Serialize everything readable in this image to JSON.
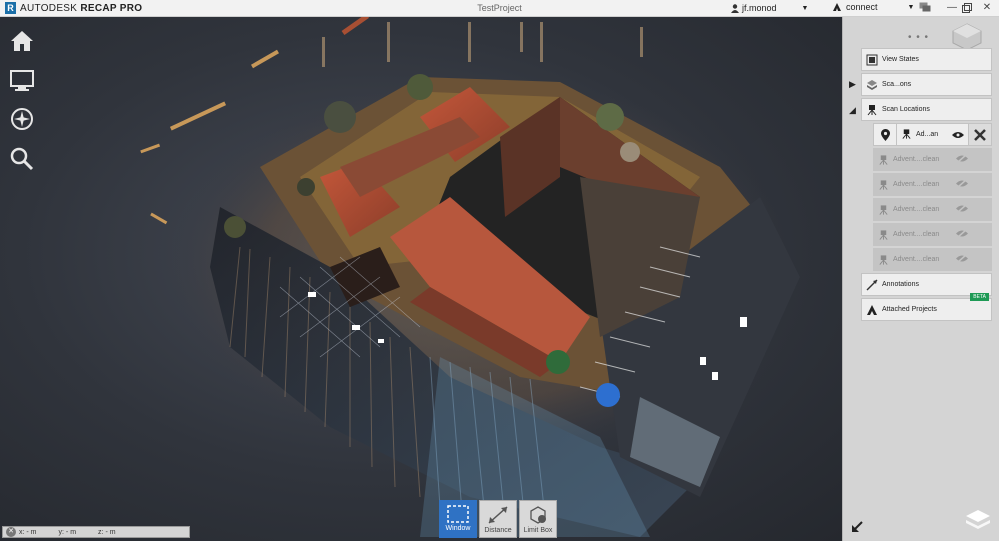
{
  "app": {
    "brand_prefix": "AUTODESK",
    "brand_product": "RECAP PRO",
    "project_title": "TestProject",
    "user": "jf.monod",
    "connect_label": "connect",
    "icons": [
      "recap-logo-icon",
      "user-icon",
      "connect-icon",
      "chat-icon",
      "minimize-icon",
      "restore-icon",
      "close-icon"
    ]
  },
  "left_tools": {
    "home_icon": "home-icon",
    "monitor_icon": "monitor-icon",
    "compass_icon": "compass-icon",
    "search_icon": "search-icon"
  },
  "toolbar": {
    "window_label": "Window",
    "distance_label": "Distance",
    "limitbox_label": "Limit Box"
  },
  "coords": {
    "x_label": "x:",
    "x_value": "- m",
    "y_label": "y:",
    "y_value": "- m",
    "z_label": "z:",
    "z_value": "- m"
  },
  "panel": {
    "dots": "• • •",
    "view_states": "View States",
    "scans": "Sca...ons",
    "scan_locations": "Scan Locations",
    "active_location": "Ad...an",
    "locations": [
      "Advent....clean",
      "Advent....clean",
      "Advent....clean",
      "Advent....clean",
      "Advent....clean"
    ],
    "annotations": "Annotations",
    "attached_projects": "Attached Projects",
    "beta_badge": "BETA"
  },
  "colors": {
    "accent": "#2f72c4",
    "beta": "#1e9a55",
    "panel_bg": "#d4d4d4"
  }
}
